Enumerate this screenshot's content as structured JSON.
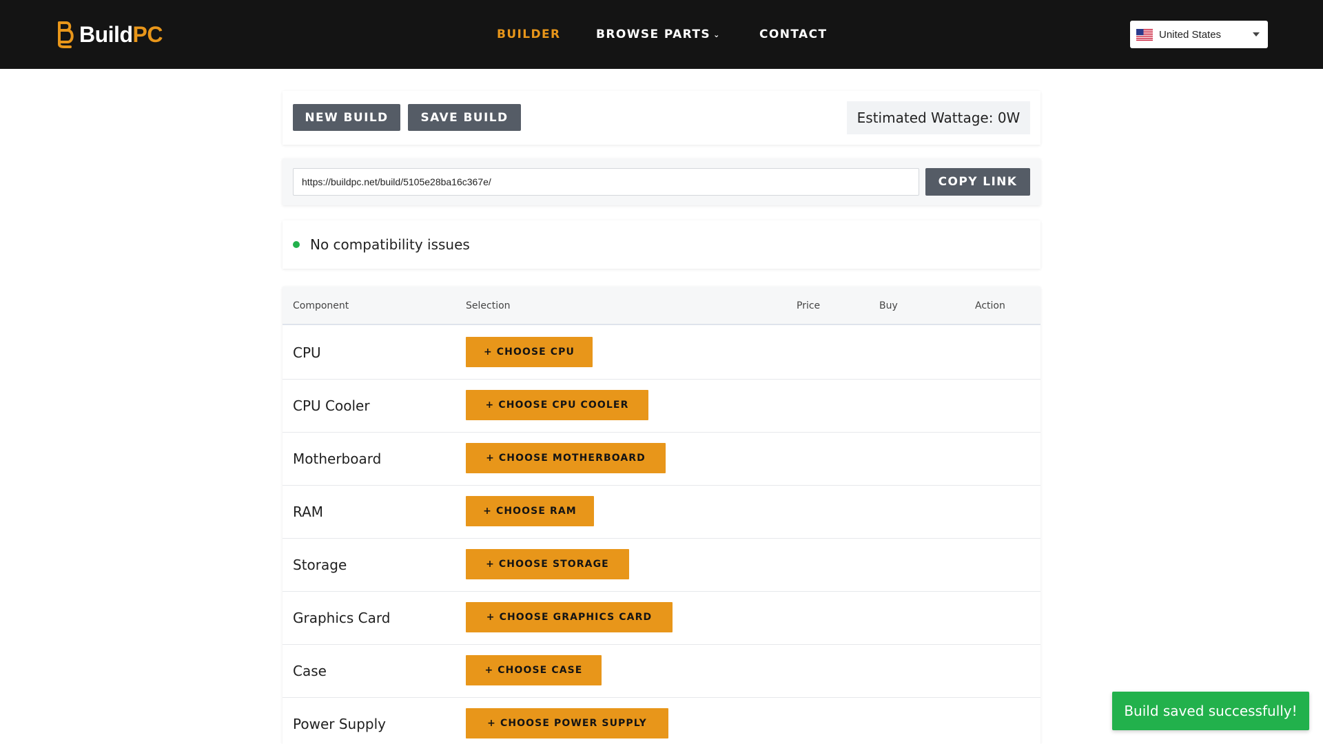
{
  "header": {
    "logo_part1": "Build",
    "logo_part2": "PC",
    "nav": [
      {
        "label": "BUILDER",
        "active": true
      },
      {
        "label": "BROWSE PARTS",
        "active": false,
        "has_dropdown": true
      },
      {
        "label": "CONTACT",
        "active": false
      }
    ],
    "country": "United States",
    "dropdown_icon": "chevron-down-icon"
  },
  "actions": {
    "new_build": "NEW BUILD",
    "save_build": "SAVE BUILD",
    "wattage": "Estimated Wattage: 0W"
  },
  "share": {
    "url": "https://buildpc.net/build/5105e28ba16c367e/",
    "copy_label": "COPY LINK"
  },
  "compatibility": {
    "status": "ok",
    "message": "No compatibility issues"
  },
  "table": {
    "headers": {
      "component": "Component",
      "selection": "Selection",
      "price": "Price",
      "buy": "Buy",
      "action": "Action"
    },
    "rows": [
      {
        "component": "CPU",
        "button": "+ CHOOSE CPU"
      },
      {
        "component": "CPU Cooler",
        "button": "+ CHOOSE CPU COOLER"
      },
      {
        "component": "Motherboard",
        "button": "+ CHOOSE MOTHERBOARD"
      },
      {
        "component": "RAM",
        "button": "+ CHOOSE RAM"
      },
      {
        "component": "Storage",
        "button": "+ CHOOSE STORAGE"
      },
      {
        "component": "Graphics Card",
        "button": "+ CHOOSE GRAPHICS CARD"
      },
      {
        "component": "Case",
        "button": "+ CHOOSE CASE"
      },
      {
        "component": "Power Supply",
        "button": "+ CHOOSE POWER SUPPLY"
      }
    ]
  },
  "toast": {
    "message": "Build saved successfully!"
  },
  "colors": {
    "accent": "#e8961a",
    "header_bg": "#141414",
    "button_gray": "#555c66",
    "success": "#22b14c"
  }
}
